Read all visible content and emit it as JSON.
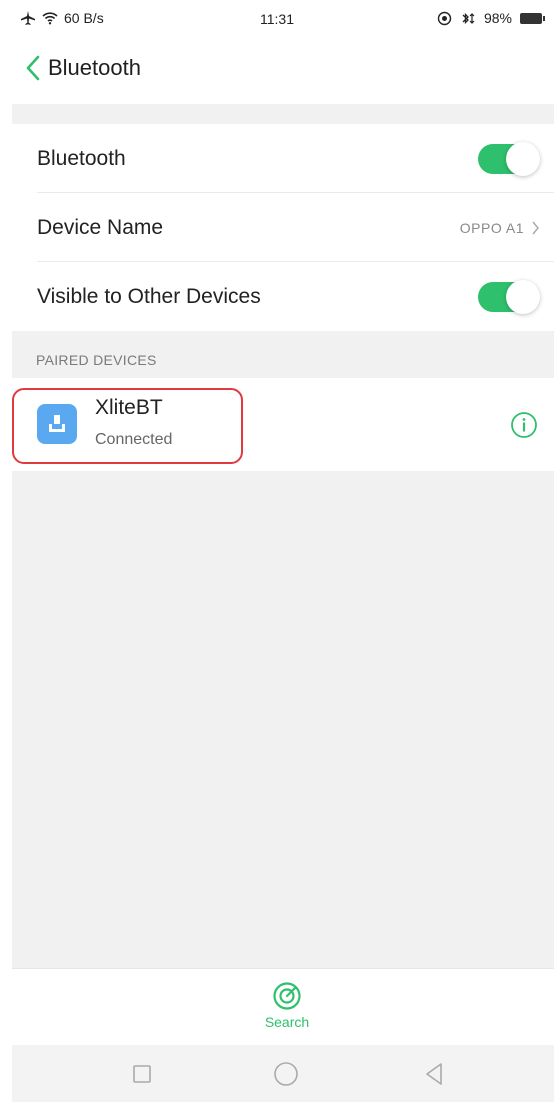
{
  "status_bar": {
    "network_speed": "60 B/s",
    "time": "11:31",
    "battery": "98%"
  },
  "header": {
    "title": "Bluetooth"
  },
  "settings": {
    "bluetooth_label": "Bluetooth",
    "bluetooth_on": true,
    "device_name_label": "Device Name",
    "device_name_value": "OPPO A1",
    "visible_label": "Visible to Other Devices",
    "visible_on": true
  },
  "paired": {
    "section_title": "PAIRED DEVICES",
    "devices": [
      {
        "name": "XliteBT",
        "status": "Connected"
      }
    ]
  },
  "bottom": {
    "search_label": "Search"
  },
  "colors": {
    "accent": "#2ec06c",
    "highlight": "#e0393e",
    "device_icon": "#5aa9f0"
  }
}
